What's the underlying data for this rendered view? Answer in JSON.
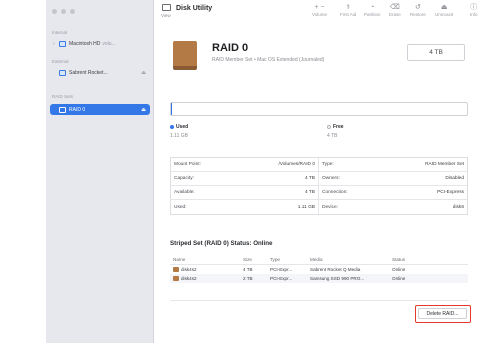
{
  "app": {
    "title": "Disk Utility",
    "view_label": "View"
  },
  "toolbar": {
    "buttons": [
      {
        "label": "Volume",
        "icon": "plus-minus-icon"
      },
      {
        "label": "First Aid",
        "icon": "stethoscope-icon"
      },
      {
        "label": "Partition",
        "icon": "partition-icon"
      },
      {
        "label": "Erase",
        "icon": "erase-icon"
      },
      {
        "label": "Restore",
        "icon": "restore-icon"
      },
      {
        "label": "Unmount",
        "icon": "unmount-icon"
      },
      {
        "label": "Info",
        "icon": "info-icon"
      }
    ]
  },
  "sidebar": {
    "sections": [
      "Internal",
      "External",
      "RAID Sets"
    ],
    "items": [
      {
        "label": "Macintosh HD",
        "trail": "volu...",
        "section": "Internal"
      },
      {
        "label": "Sabrent Rocket...",
        "section": "External"
      },
      {
        "label": "RAID 0",
        "section": "RAID Sets",
        "selected": true
      }
    ]
  },
  "header": {
    "name": "RAID 0",
    "subtitle": "RAID Member Set • Mac OS Extended (Journaled)",
    "capacity": "4 TB"
  },
  "usage": {
    "used_fraction": 0.0003,
    "used_label": "Used",
    "used_value": "1.11 GB",
    "free_label": "Free",
    "free_value": "4 TB",
    "used_color": "#3478e8",
    "free_color": "#ffffff"
  },
  "info": {
    "rows": [
      {
        "l_label": "Mount Point:",
        "l_value": "/Volumes/RAID 0",
        "r_label": "Type:",
        "r_value": "RAID Member Set"
      },
      {
        "l_label": "Capacity:",
        "l_value": "4 TB",
        "r_label": "Owners:",
        "r_value": "Disabled"
      },
      {
        "l_label": "Available:",
        "l_value": "4 TB",
        "r_label": "Connection:",
        "r_value": "PCI-Express"
      },
      {
        "l_label": "Used:",
        "l_value": "1.11 GB",
        "r_label": "Device:",
        "r_value": "disk6"
      }
    ]
  },
  "set": {
    "title": "Striped Set (RAID 0) Status: Online",
    "columns": [
      "Name",
      "Size",
      "Type",
      "Media",
      "Status"
    ],
    "members": [
      {
        "name": "disk4s2",
        "size": "4 TB",
        "type": "PCI-Expr...",
        "media": "Sabrent Rocket Q Media",
        "status": "Online"
      },
      {
        "name": "disk4s2",
        "size": "2 TB",
        "type": "PCI-Expr...",
        "media": "Samsung SSD 990 PRO...",
        "status": "Online"
      }
    ],
    "delete_label": "Delete RAID..."
  },
  "colors": {
    "accent": "#3478e8",
    "highlight": "#e43a2e",
    "disk": "#b47a46"
  }
}
